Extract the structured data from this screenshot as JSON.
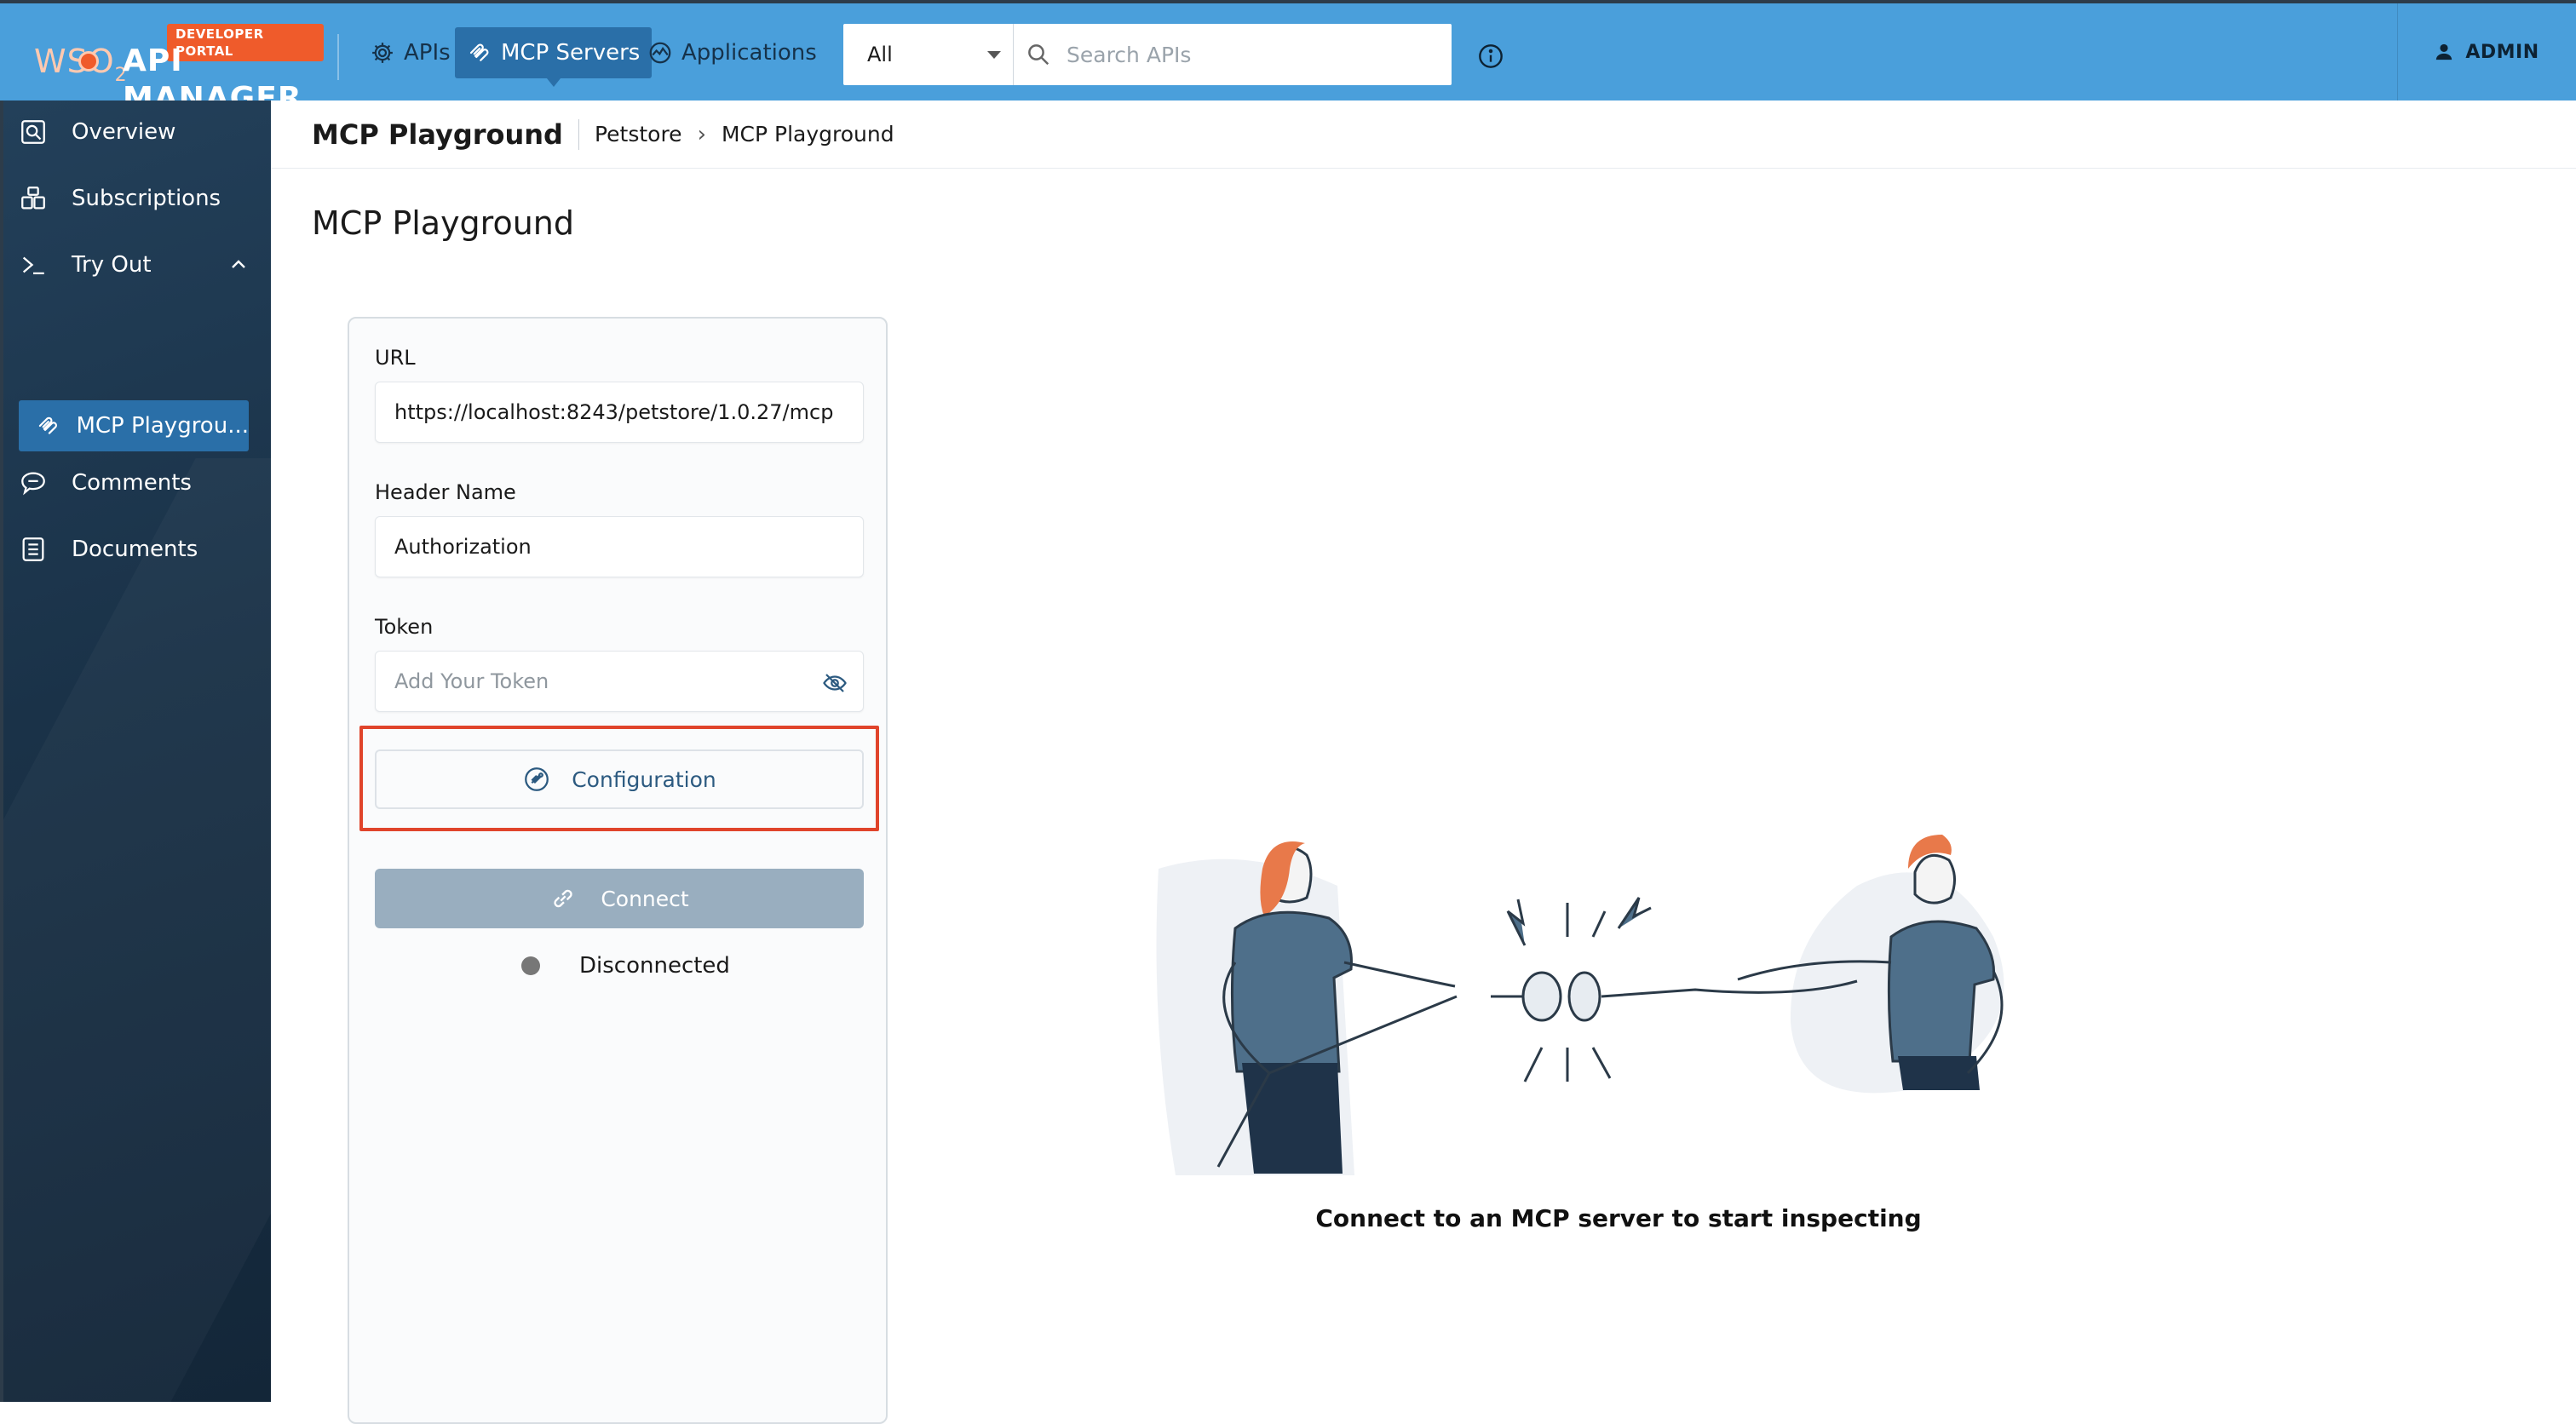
{
  "header": {
    "badge": "DEVELOPER PORTAL",
    "logo_wso": "WSO",
    "logo_two": "2",
    "product": "API MANAGER",
    "nav": [
      {
        "label": "APIs",
        "icon": "gear-icon"
      },
      {
        "label": "MCP Servers",
        "icon": "mcp-icon",
        "active": true
      },
      {
        "label": "Applications",
        "icon": "applications-icon"
      }
    ],
    "search": {
      "filter_value": "All",
      "placeholder": "Search APIs"
    },
    "user": "ADMIN"
  },
  "sidebar": {
    "items": [
      {
        "label": "Overview",
        "icon": "overview-icon"
      },
      {
        "label": "Subscriptions",
        "icon": "subscriptions-icon"
      },
      {
        "label": "Try Out",
        "icon": "terminal-icon",
        "expanded": true
      },
      {
        "label": "MCP Playgrou...",
        "icon": "mcp-icon",
        "active": true
      },
      {
        "label": "Comments",
        "icon": "comments-icon"
      },
      {
        "label": "Documents",
        "icon": "documents-icon"
      }
    ]
  },
  "breadcrumb": {
    "title": "MCP Playground",
    "parent": "Petstore",
    "current": "MCP Playground"
  },
  "main": {
    "title": "MCP Playground",
    "form": {
      "url_label": "URL",
      "url_value": "https://localhost:8243/petstore/1.0.27/mcp",
      "header_label": "Header Name",
      "header_value": "Authorization",
      "token_label": "Token",
      "token_placeholder": "Add Your Token",
      "configuration_label": "Configuration",
      "connect_label": "Connect",
      "status": "Disconnected"
    },
    "empty_message": "Connect to an MCP server to start inspecting"
  },
  "colors": {
    "topbar": "#4a9fdb",
    "active": "#2a6fa8",
    "sidebar": "#1a3248",
    "badge": "#ef5b2b",
    "highlight": "#e0442b",
    "connect_disabled": "#99aebf"
  }
}
